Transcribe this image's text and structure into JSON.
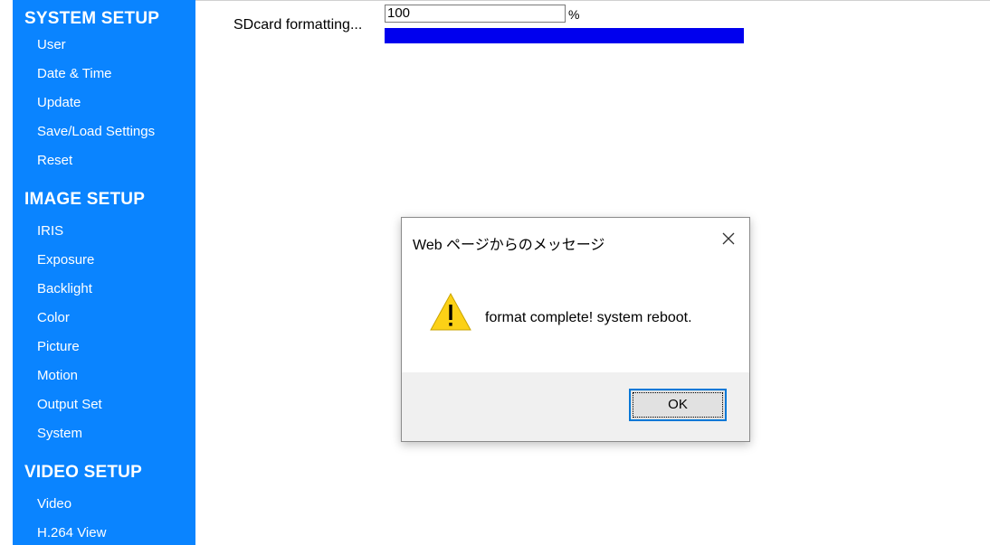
{
  "sidebar": {
    "system_setup": {
      "title": "SYSTEM SETUP",
      "items": [
        "User",
        "Date & Time",
        "Update",
        "Save/Load Settings",
        "Reset"
      ]
    },
    "image_setup": {
      "title": "IMAGE SETUP",
      "items": [
        "IRIS",
        "Exposure",
        "Backlight",
        "Color",
        "Picture",
        "Motion",
        "Output Set",
        "System"
      ]
    },
    "video_setup": {
      "title": "VIDEO SETUP",
      "items": [
        "Video",
        "H.264 View"
      ]
    },
    "colors": {
      "background": "#0a84ff",
      "text": "#ffffff"
    }
  },
  "progress": {
    "label": "SDcard formatting...",
    "value": "100",
    "unit": "%",
    "percent": 100,
    "bar_color": "#0000ee"
  },
  "dialog": {
    "title": "Web ページからのメッセージ",
    "message": "format complete! system reboot.",
    "ok_label": "OK",
    "icon": "warning-icon",
    "close_icon": "close-icon"
  }
}
